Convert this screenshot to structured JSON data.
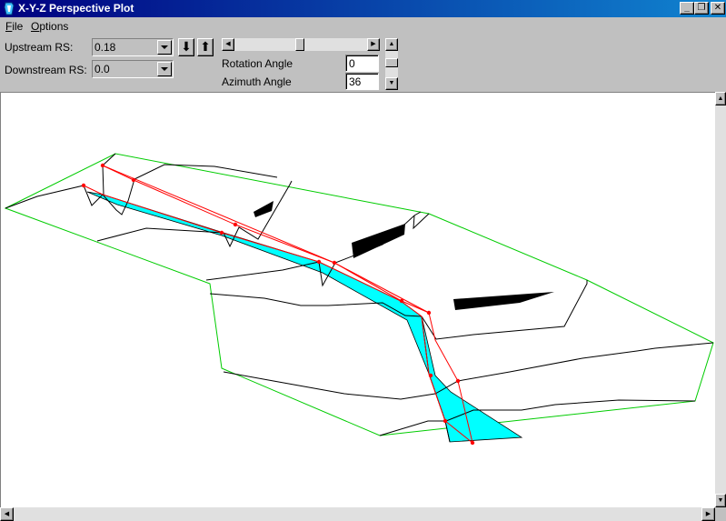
{
  "window": {
    "title": "X-Y-Z Perspective Plot",
    "controls": {
      "minimize": "_",
      "maximize": "❐",
      "close": "✕"
    }
  },
  "menu": {
    "file": {
      "accel": "F",
      "rest": "ile"
    },
    "options": {
      "accel": "O",
      "rest": "ptions"
    }
  },
  "controls": {
    "upstream_label": "Upstream RS:",
    "upstream_value": "0.18",
    "downstream_label": "Downstream RS:",
    "downstream_value": "0.0",
    "rotation_label": "Rotation Angle",
    "rotation_value": "0",
    "azimuth_label": "Azimuth Angle",
    "azimuth_value": "36"
  },
  "icons": {
    "down_arrow": "⬇",
    "up_arrow": "⬆",
    "scroll_left": "◀",
    "scroll_right": "▶",
    "scroll_up": "▲",
    "scroll_down": "▼"
  },
  "colors": {
    "titlebar": "#000080",
    "boundary": "#00cc00",
    "reach_line": "#ff0000",
    "water": "#00ffff",
    "terrain": "#000000"
  }
}
